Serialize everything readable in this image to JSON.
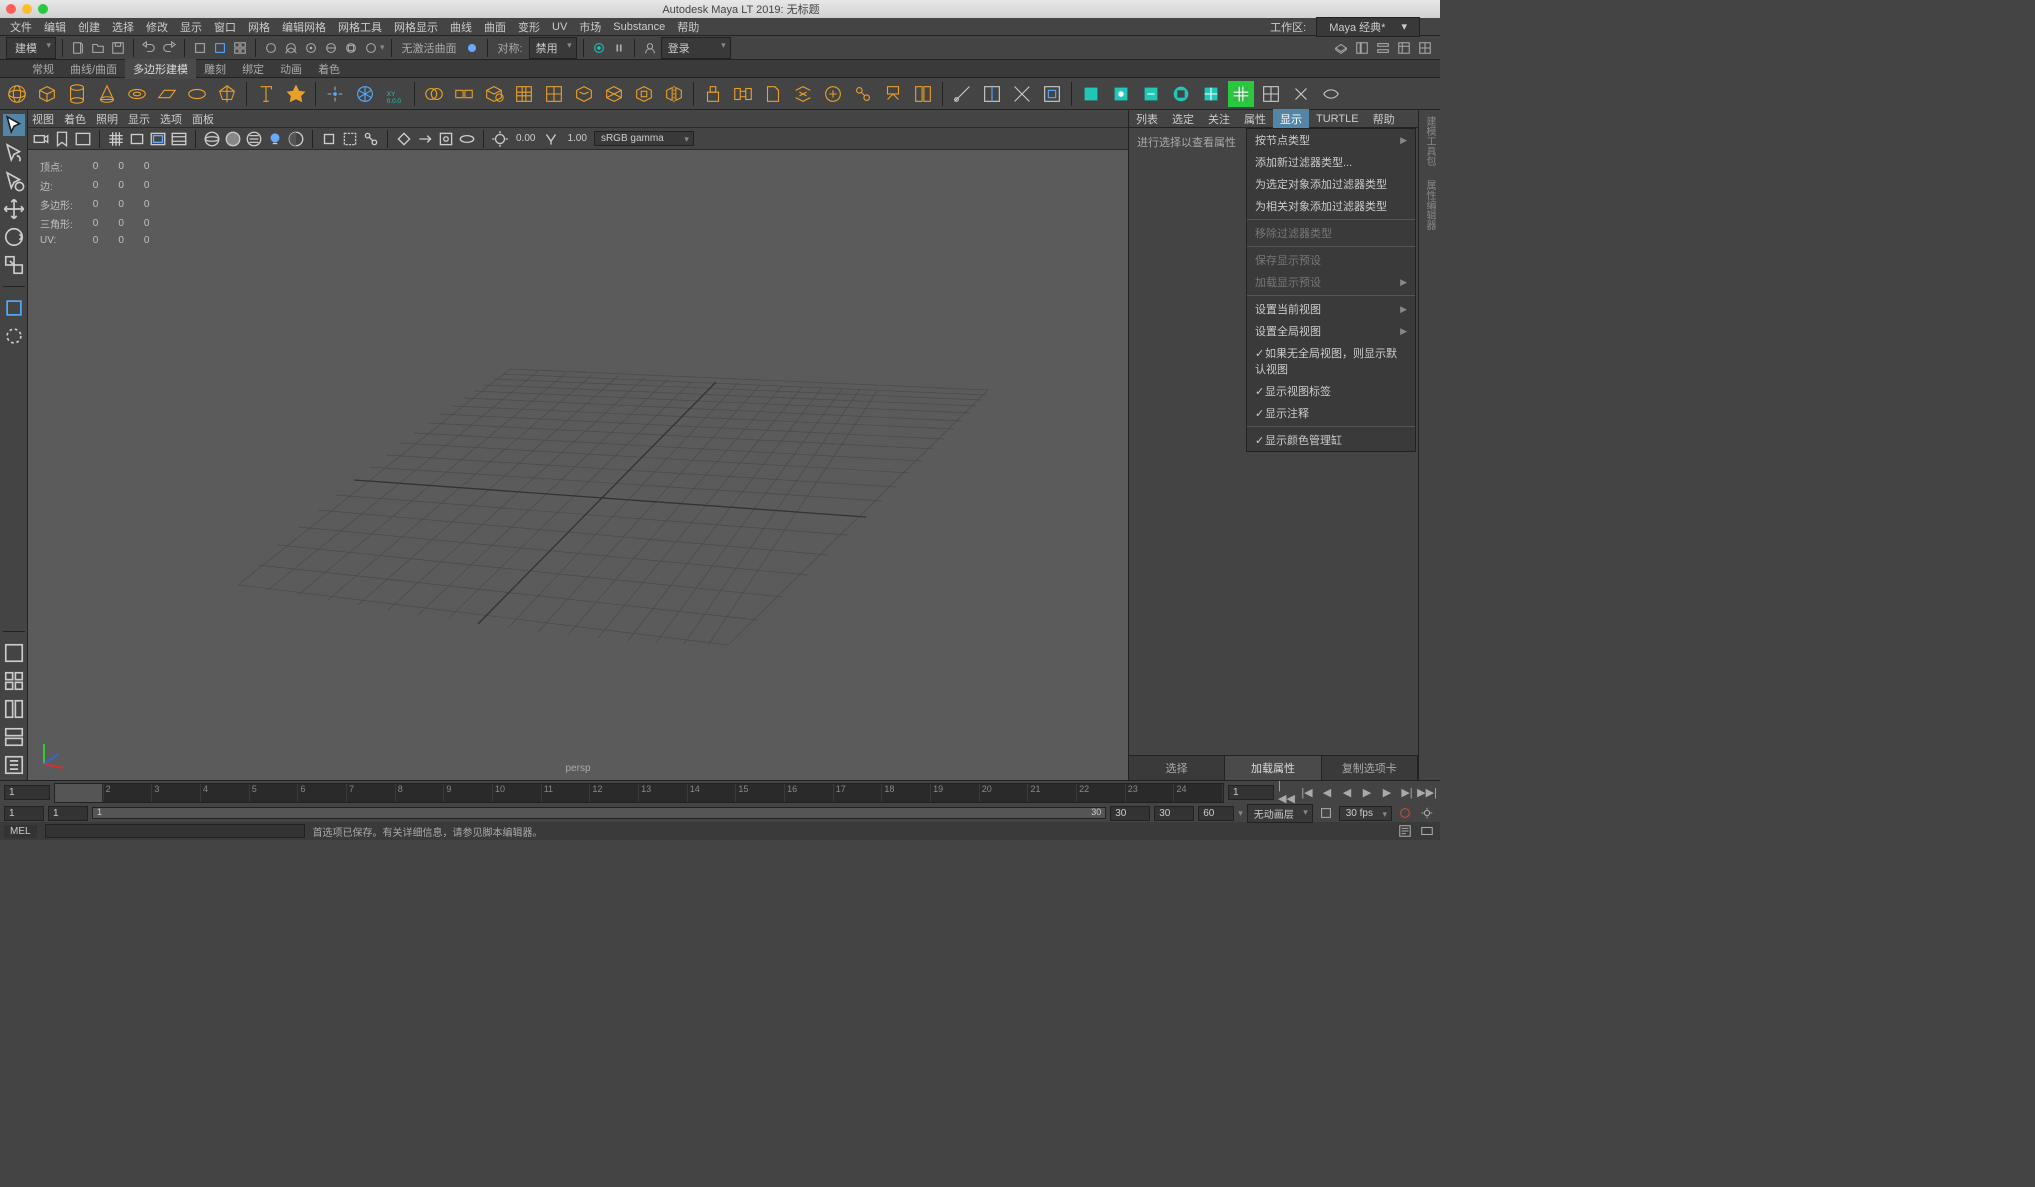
{
  "titlebar": {
    "title": "Autodesk Maya LT 2019: 无标题"
  },
  "menubar": {
    "items": [
      "文件",
      "编辑",
      "创建",
      "选择",
      "修改",
      "显示",
      "窗口",
      "网格",
      "编辑网格",
      "网格工具",
      "网格显示",
      "曲线",
      "曲面",
      "变形",
      "UV",
      "市场",
      "Substance",
      "帮助"
    ],
    "workspace_label": "工作区:",
    "workspace_value": "Maya 经典*"
  },
  "toolbar": {
    "mode_dropdown": "建模",
    "no_active_surface": "无激活曲面",
    "sym_label": "对称:",
    "sym_value": "禁用",
    "login_label": "登录"
  },
  "shelf_tabs": [
    "常规",
    "曲线/曲面",
    "多边形建模",
    "雕刻",
    "绑定",
    "动画",
    "着色"
  ],
  "shelf_active": 2,
  "panel_menu": [
    "视图",
    "着色",
    "照明",
    "显示",
    "选项",
    "面板"
  ],
  "panel_tools": {
    "exposure": "0.00",
    "gamma": "1.00",
    "colorspace": "sRGB gamma"
  },
  "hud": {
    "rows": [
      {
        "label": "顶点:",
        "v1": "0",
        "v2": "0",
        "v3": "0"
      },
      {
        "label": "边:",
        "v1": "0",
        "v2": "0",
        "v3": "0"
      },
      {
        "label": "多边形:",
        "v1": "0",
        "v2": "0",
        "v3": "0"
      },
      {
        "label": "三角形:",
        "v1": "0",
        "v2": "0",
        "v3": "0"
      },
      {
        "label": "UV:",
        "v1": "0",
        "v2": "0",
        "v3": "0"
      }
    ],
    "camera": "persp"
  },
  "right_panel": {
    "tabs": [
      "列表",
      "选定",
      "关注",
      "属性",
      "显示",
      "TURTLE",
      "帮助"
    ],
    "active_tab": 4,
    "hint": "进行选择以查看属性",
    "menu": [
      {
        "label": "按节点类型",
        "type": "submenu"
      },
      {
        "label": "添加新过滤器类型...",
        "type": "item"
      },
      {
        "label": "为选定对象添加过滤器类型",
        "type": "item"
      },
      {
        "label": "为相关对象添加过滤器类型",
        "type": "item"
      },
      {
        "type": "sep"
      },
      {
        "label": "移除过滤器类型",
        "type": "disabled"
      },
      {
        "type": "sep"
      },
      {
        "label": "保存显示预设",
        "type": "disabled"
      },
      {
        "label": "加载显示预设",
        "type": "disabled-submenu"
      },
      {
        "type": "sep"
      },
      {
        "label": "设置当前视图",
        "type": "submenu"
      },
      {
        "label": "设置全局视图",
        "type": "submenu"
      },
      {
        "label": "如果无全局视图，则显示默认视图",
        "type": "check",
        "checked": true
      },
      {
        "label": "显示视图标签",
        "type": "check",
        "checked": true
      },
      {
        "label": "显示注释",
        "type": "check",
        "checked": true
      },
      {
        "type": "sep"
      },
      {
        "label": "显示颜色管理缸",
        "type": "check",
        "checked": true
      }
    ],
    "bottom_tabs": [
      "选择",
      "加载属性",
      "复制选项卡"
    ],
    "bottom_active": 1
  },
  "right_strip": [
    "建模工具包",
    "属性编辑器"
  ],
  "timeline": {
    "start_frame": "1",
    "end_frame": "1",
    "ticks": [
      "1",
      "2",
      "3",
      "4",
      "5",
      "6",
      "7",
      "8",
      "9",
      "10",
      "11",
      "12",
      "13",
      "14",
      "15",
      "16",
      "17",
      "18",
      "19",
      "20",
      "21",
      "22",
      "23",
      "24"
    ],
    "range_start": "1",
    "range_inner_start": "1",
    "range_cur": "1",
    "range_inner_end": "30",
    "range_end": "30",
    "fps_value": "60",
    "anim_layer": "无动画层",
    "fps_dd": "30 fps"
  },
  "cmdline": {
    "label": "MEL",
    "message": "首选项已保存。有关详细信息，请参见脚本编辑器。"
  }
}
